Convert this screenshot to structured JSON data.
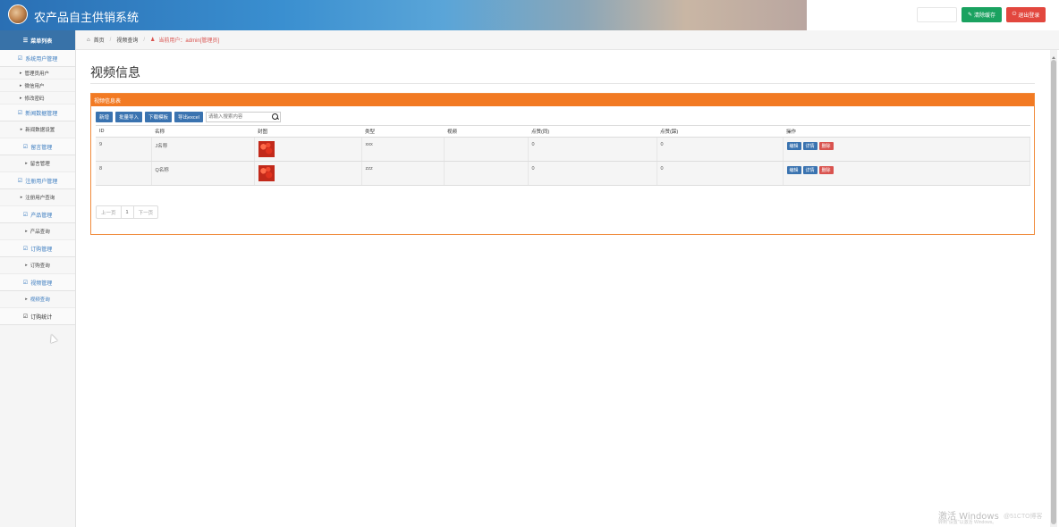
{
  "header": {
    "app_title": "农产品自主供销系统",
    "btn_ghost": "",
    "btn_clear_cache": "清除缓存",
    "btn_logout": "退出登录",
    "colors": {
      "banner": "#2a6fb4",
      "green": "#1aa260",
      "red": "#e2473e"
    }
  },
  "sidebar": {
    "menu_title": "菜单列表",
    "groups": [
      {
        "label": "系统用户管理",
        "items": [
          "管理员用户",
          "微信用户",
          "修改密码"
        ]
      },
      {
        "label": "新闻数据管理",
        "items": [
          "新闻数据设置"
        ]
      },
      {
        "label": "留言管理",
        "items": [
          "留言管理"
        ]
      },
      {
        "label": "注册用户管理",
        "items": [
          "注册用户查询"
        ]
      },
      {
        "label": "产品管理",
        "items": [
          "产品查询"
        ]
      },
      {
        "label": "订购管理",
        "items": [
          "订购查询"
        ]
      },
      {
        "label": "视频管理",
        "items": [
          "视频查询"
        ]
      },
      {
        "label": "订购统计",
        "items": []
      }
    ]
  },
  "breadcrumb": {
    "home": "首页",
    "current": "视频查询",
    "user_text": "当前用户：admin[管理员]"
  },
  "page": {
    "title": "视频信息"
  },
  "panel": {
    "title": "视频信息表",
    "toolbar": {
      "add": "新增",
      "import": "批量导入",
      "template": "下载模板",
      "export": "导出excel",
      "search_placeholder": "请输入搜索内容"
    },
    "columns": [
      "ID",
      "名称",
      "封图",
      "类型",
      "视频",
      "点赞(同)",
      "点赞(踩)",
      "操作"
    ],
    "rows": [
      {
        "id": "9",
        "name": "J名称",
        "type": "xxx",
        "video": "",
        "likes": "0",
        "dislikes": "0"
      },
      {
        "id": "8",
        "name": "Q名称",
        "type": "zzz",
        "video": "",
        "likes": "0",
        "dislikes": "0"
      }
    ],
    "ops": {
      "edit": "编辑",
      "detail": "详情",
      "delete": "删除"
    },
    "pager": {
      "prev": "上一页",
      "page": "1",
      "next": "下一页"
    }
  },
  "watermark": {
    "line1": "激活 Windows",
    "line2": "转到\"设置\"以激活 Windows。",
    "site": "@51CTO博客"
  }
}
